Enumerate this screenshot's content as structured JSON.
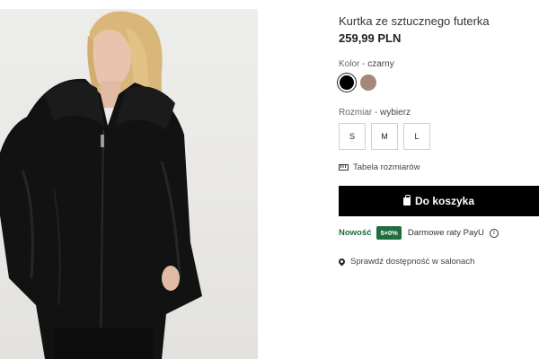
{
  "product": {
    "title": "Kurtka ze sztucznego futerka",
    "price": "259,99 PLN",
    "image_alt": "product-photo"
  },
  "color": {
    "label": "Kolor",
    "separator": " - ",
    "selected": "czarny",
    "swatches": [
      {
        "name": "black",
        "hex": "#000000",
        "selected": true
      },
      {
        "name": "brown",
        "hex": "#a6877c",
        "selected": false
      }
    ]
  },
  "size": {
    "label": "Rozmiar",
    "separator": " - ",
    "selected": "wybierz",
    "options": [
      "S",
      "M",
      "L"
    ]
  },
  "size_table": {
    "label": "Tabela rozmiarów",
    "icon": "ruler-icon"
  },
  "cart": {
    "label": "Do koszyka",
    "icon": "shopping-bag-icon"
  },
  "payu": {
    "new_label": "Nowość",
    "badge": "5×0%",
    "text": "Darmowe raty PayU",
    "icon": "info-icon"
  },
  "store": {
    "label": "Sprawdź dostępność w salonach",
    "icon": "location-pin-icon"
  },
  "colors": {
    "primary": "#000000",
    "accent_green": "#1f6e3e"
  }
}
